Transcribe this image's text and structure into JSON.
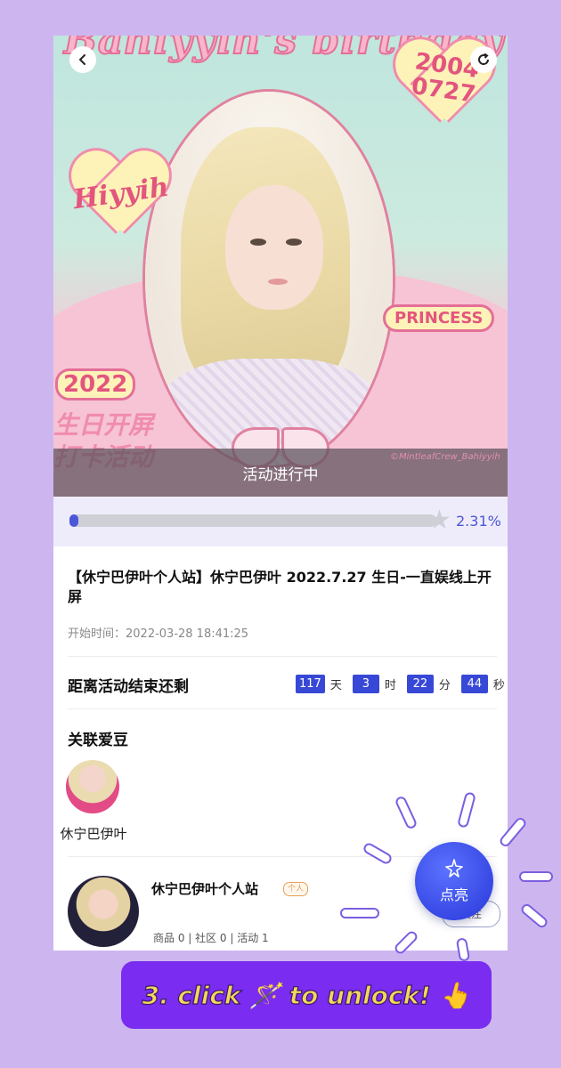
{
  "banner": {
    "title": "Bahiyyih's birthday",
    "date_line1": "2004",
    "date_line2": "0727",
    "tag_name": "Hiyyih",
    "tag_princess": "PRINCESS",
    "year": "2022",
    "promo_line1": "生日开屏",
    "promo_line2": "打卡活动",
    "watermark": "©MintleafCrew_Bahiyyih",
    "status": "活动进行中"
  },
  "progress": {
    "fraction": 0.0231,
    "percent_label": "2.31%"
  },
  "event": {
    "title": "【休宁巴伊叶个人站】休宁巴伊叶 2022.7.27 生日-一直娱线上开屏",
    "start_time": "开始时间：2022-03-28 18:41:25"
  },
  "countdown": {
    "label": "距离活动结束还剩",
    "days": "117",
    "days_unit": "天",
    "hours": "3",
    "hours_unit": "时",
    "minutes": "22",
    "minutes_unit": "分",
    "seconds": "44",
    "seconds_unit": "秒"
  },
  "idol": {
    "section_title": "关联爱豆",
    "name": "休宁巴伊叶"
  },
  "station": {
    "name": "休宁巴伊叶个人站",
    "badge": "个人",
    "stats": "商品 0 | 社区 0 | 活动 1",
    "follow_label": "关注"
  },
  "fab": {
    "label": "点亮",
    "icon": "sparkle-wand-icon"
  },
  "hint": {
    "text": "3. click 🪄 to unlock! 👆"
  },
  "icons": {
    "back": "back-chevron-icon",
    "refresh": "refresh-icon"
  },
  "colors": {
    "accent": "#3848d6",
    "background": "#cdb6f0",
    "hint_bg": "#7a2cf0",
    "hint_text": "#f5d75a"
  }
}
